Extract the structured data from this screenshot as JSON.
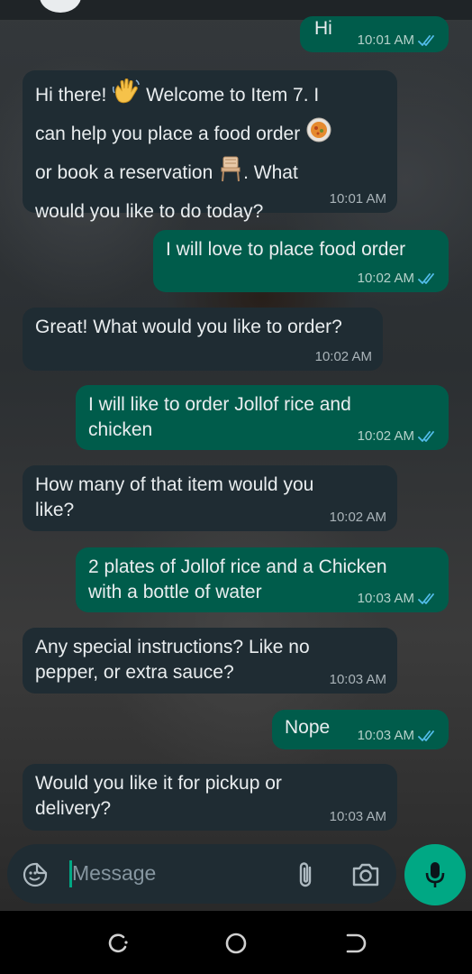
{
  "chat": {
    "messages": [
      {
        "text": "Hi",
        "time": "10:01 AM",
        "read": true
      },
      {
        "text_1": "Hi there!",
        "text_2": "Welcome to Item 7. I",
        "text_3": "can help you place a food order",
        "text_4": "or book a reservation",
        "text_5": ". What",
        "text_6": "would you like to do today?",
        "time": "10:01 AM"
      },
      {
        "text": "I will love to place food order",
        "time": "10:02 AM",
        "read": true
      },
      {
        "text": "Great! What would you like to order?",
        "time": "10:02 AM"
      },
      {
        "text_1": "I will like to order Jollof rice and",
        "text_2": "chicken",
        "time": "10:02 AM",
        "read": true
      },
      {
        "text_1": "How many of that item would you",
        "text_2": "like?",
        "time": "10:02 AM"
      },
      {
        "text_1": "2 plates of Jollof rice and a Chicken",
        "text_2": "with a bottle of water",
        "time": "10:03 AM",
        "read": true
      },
      {
        "text_1": "Any special instructions? Like no",
        "text_2": "pepper, or extra sauce?",
        "time": "10:03 AM"
      },
      {
        "text": "Nope",
        "time": "10:03 AM",
        "read": true
      },
      {
        "text_1": "Would you like it for pickup or",
        "text_2": "delivery?",
        "time": "10:03 AM"
      }
    ]
  },
  "composer": {
    "placeholder": "Message",
    "icons": [
      "sticker-icon",
      "attach-icon",
      "camera-icon",
      "mic-icon"
    ]
  },
  "navigation": {
    "icons": [
      "recents-icon",
      "home-icon",
      "back-icon"
    ]
  },
  "colors": {
    "incoming": "#1f2c33",
    "outgoing": "#005c4b",
    "accent": "#00a884",
    "read_ticks": "#53bdeb"
  }
}
